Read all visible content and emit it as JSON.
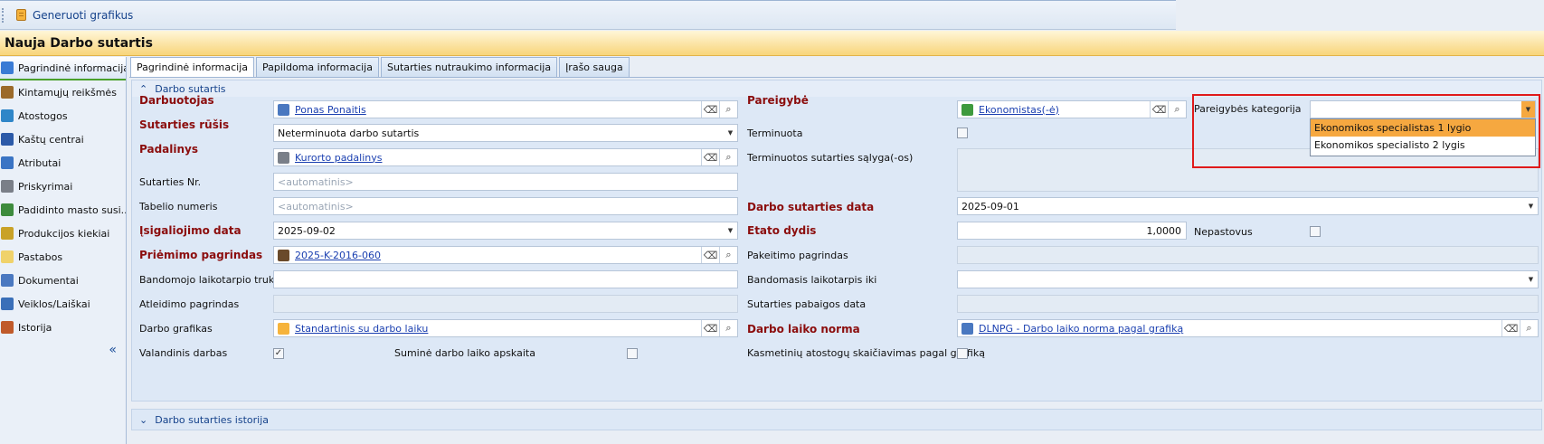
{
  "toolbar": {
    "generate_label": "Generuoti grafikus"
  },
  "title": "Nauja Darbo sutartis",
  "sidebar": {
    "items": [
      {
        "label": "Pagrindinė informacija",
        "icon": "db-icon",
        "color": "#3a7bd5",
        "active": true
      },
      {
        "label": "Kintamųjų reikšmės",
        "icon": "book-icon",
        "color": "#9b6a2a"
      },
      {
        "label": "Atostogos",
        "icon": "beach-icon",
        "color": "#2f86c8"
      },
      {
        "label": "Kaštų centrai",
        "icon": "coins-icon",
        "color": "#2c5aa8"
      },
      {
        "label": "Atributai",
        "icon": "tag-icon",
        "color": "#3a74c4"
      },
      {
        "label": "Priskyrimai",
        "icon": "building-icon",
        "color": "#7a7f88"
      },
      {
        "label": "Padidinto masto susi...",
        "icon": "grid-icon",
        "color": "#3d8b3d"
      },
      {
        "label": "Produkcijos kiekiai",
        "icon": "box-icon",
        "color": "#c9a227"
      },
      {
        "label": "Pastabos",
        "icon": "note-icon",
        "color": "#f0d26a"
      },
      {
        "label": "Dokumentai",
        "icon": "doc-icon",
        "color": "#4a78c0"
      },
      {
        "label": "Veiklos/Laiškai",
        "icon": "mail-icon",
        "color": "#3a6fb8"
      },
      {
        "label": "Istorija",
        "icon": "clock-icon",
        "color": "#c05a2a"
      }
    ],
    "collapse_label": "«"
  },
  "tabs": [
    "Pagrindinė informacija",
    "Papildoma informacija",
    "Sutarties nutraukimo informacija",
    "Įrašo sauga"
  ],
  "panel": {
    "header": "Darbo sutartis",
    "left": {
      "employee_label": "Darbuotojas",
      "employee_value": "Ponas Ponaitis",
      "contract_type_label": "Sutarties rūšis",
      "contract_type_value": "Neterminuota darbo sutartis",
      "unit_label": "Padalinys",
      "unit_value": "Kurorto padalinys",
      "contract_no_label": "Sutarties Nr.",
      "contract_no_placeholder": "<automatinis>",
      "tab_no_label": "Tabelio numeris",
      "tab_no_placeholder": "<automatinis>",
      "effective_date_label": "Įsigaliojimo data",
      "effective_date_value": "2025-09-02",
      "hire_basis_label": "Priėmimo pagrindas",
      "hire_basis_value": "2025-K-2016-060",
      "probation_label": "Bandomojo laikotarpio trukmė",
      "dismissal_basis_label": "Atleidimo pagrindas",
      "schedule_label": "Darbo grafikas",
      "schedule_value": "Standartinis su darbo laiku",
      "hourly_label": "Valandinis darbas",
      "summary_label": "Suminė darbo laiko apskaita"
    },
    "right": {
      "position_label": "Pareigybė",
      "position_value": "Ekonomistas(-ė)",
      "fixed_term_label": "Terminuota",
      "fixed_term_condition_label": "Terminuotos sutarties sąlyga(-os)",
      "contract_date_label": "Darbo sutarties data",
      "contract_date_value": "2025-09-01",
      "fte_label": "Etato dydis",
      "fte_value": "1,0000",
      "irregular_label": "Nepastovus",
      "change_basis_label": "Pakeitimo pagrindas",
      "probation_until_label": "Bandomasis laikotarpis iki",
      "end_date_label": "Sutarties pabaigos data",
      "work_norm_label": "Darbo laiko norma",
      "work_norm_value": "DLNPG - Darbo laiko norma pagal grafiką",
      "vacation_calc_label": "Kasmetinių atostogų skaičiavimas pagal grafiką",
      "category_label": "Pareigybės kategorija"
    }
  },
  "category_dropdown": {
    "options": [
      "Ekonomikos specialistas 1 lygio",
      "Ekonomikos specialisto 2 lygis"
    ],
    "highlighted_index": 0
  },
  "history_header": "Darbo sutarties istorija",
  "colors": {
    "required_label": "#8b0d0d",
    "highlight": "#f6a840",
    "annotation": "#e01a1a"
  }
}
